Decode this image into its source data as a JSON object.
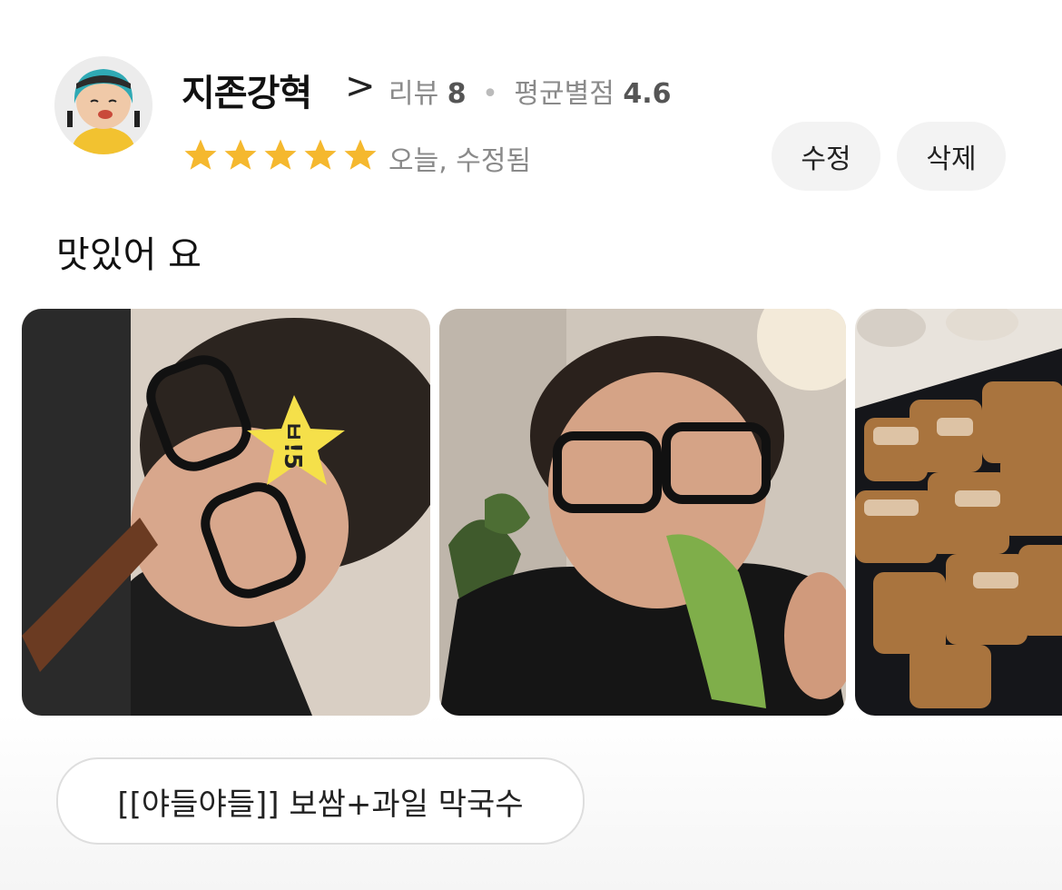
{
  "review": {
    "username": "지존강혁",
    "profile_chevron": ">",
    "review_label": "리뷰",
    "review_count": "8",
    "dot": "•",
    "avg_label": "평균별점",
    "avg_rating": "4.6",
    "stars": 5,
    "star_color": "#F5B82E",
    "date_text": "오늘, 수정됨",
    "edit_label": "수정",
    "delete_label": "삭제",
    "content": "맛있어 요",
    "menu_tag": "[[야들야들]] 보쌈+과일 막국수"
  },
  "photo_sticker_text": "ㅂ!5",
  "icons": [
    "avatar",
    "star-icon",
    "chevron-right-icon"
  ]
}
